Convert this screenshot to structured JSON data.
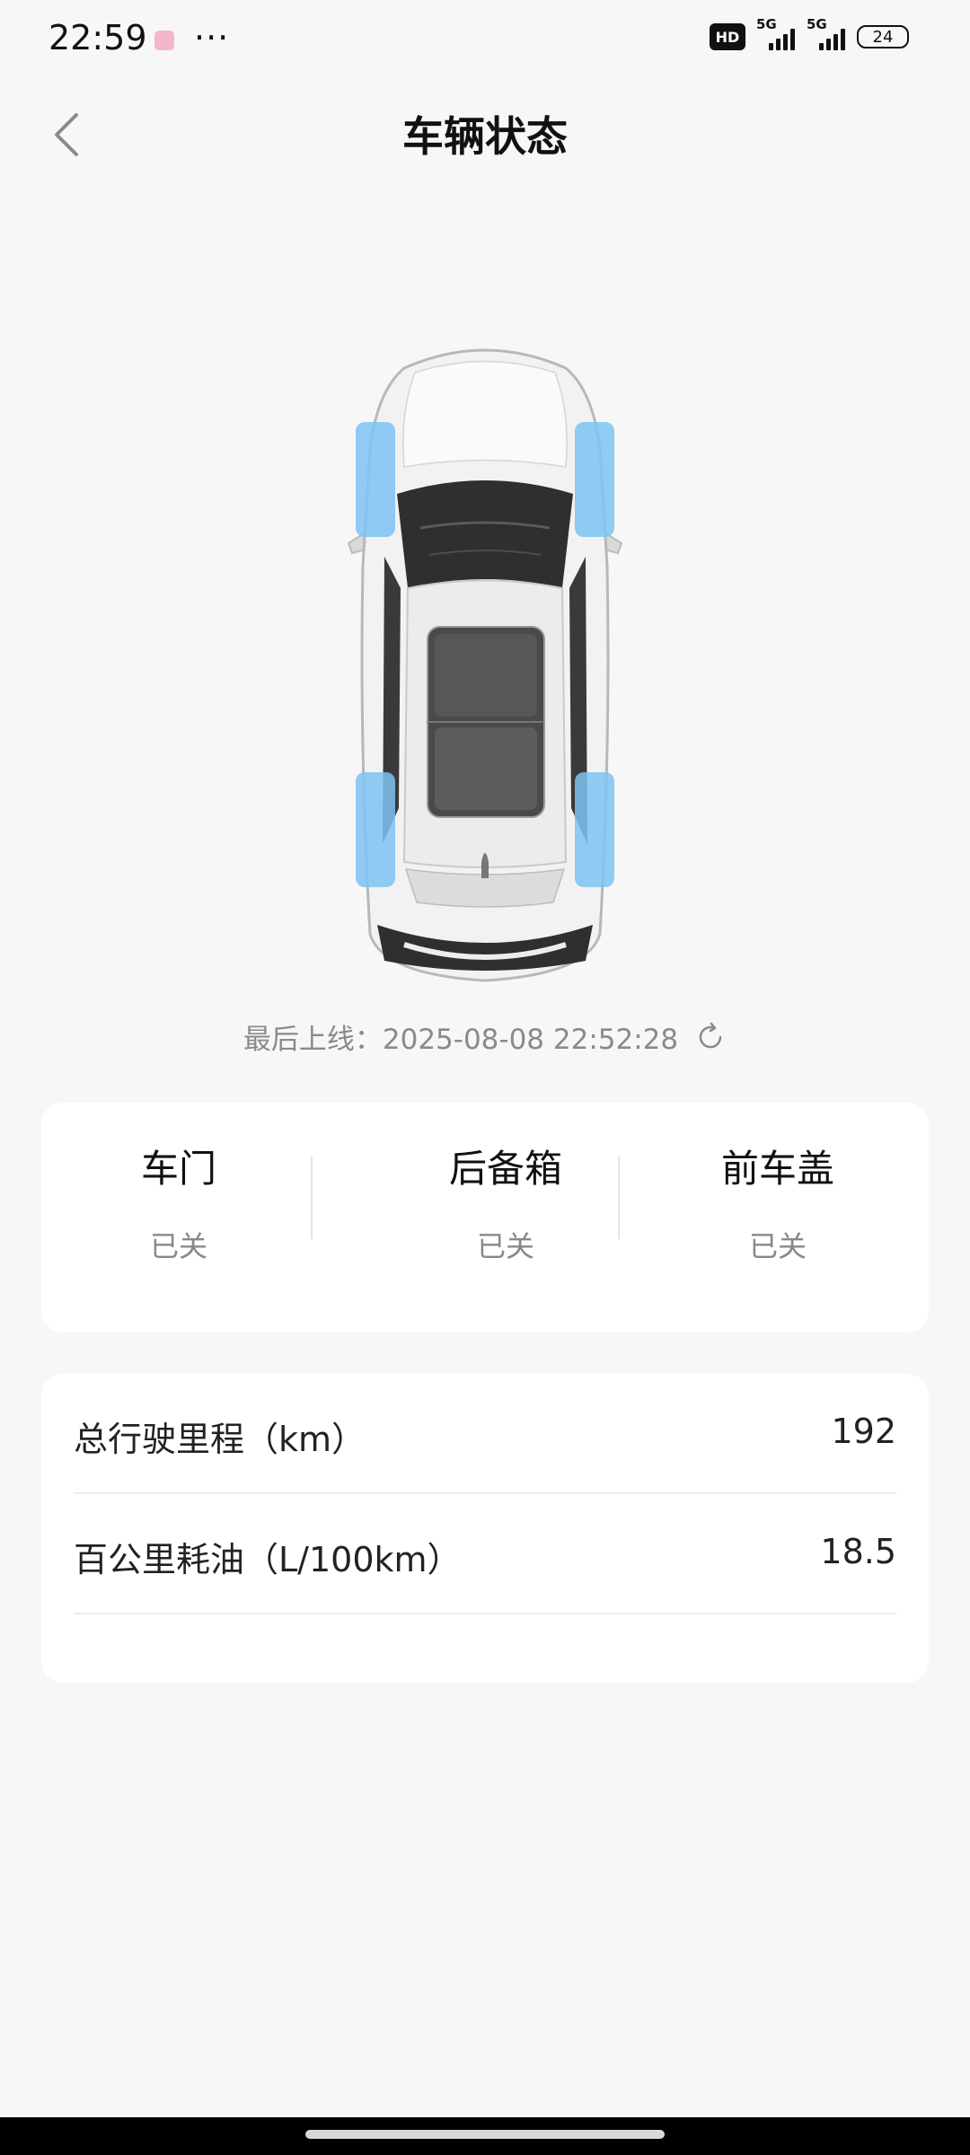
{
  "status_bar": {
    "time": "22:59",
    "more": "···",
    "hd_badge": "HD",
    "network_1": "5G",
    "network_2": "5G",
    "battery": "24"
  },
  "header": {
    "title": "车辆状态"
  },
  "car": {
    "last_online_label": "最后上线：",
    "last_online_time": "2025-08-08 22:52:28"
  },
  "closures": [
    {
      "label": "车门",
      "value": "已关"
    },
    {
      "label": "后备箱",
      "value": "已关"
    },
    {
      "label": "前车盖",
      "value": "已关"
    }
  ],
  "stats": [
    {
      "label": "总行驶里程（km）",
      "value": "192"
    },
    {
      "label": "百公里耗油（L/100km）",
      "value": "18.5"
    }
  ],
  "colors": {
    "tire_highlight": "#7cc3f2",
    "background": "#f7f7f7",
    "card": "#ffffff"
  }
}
